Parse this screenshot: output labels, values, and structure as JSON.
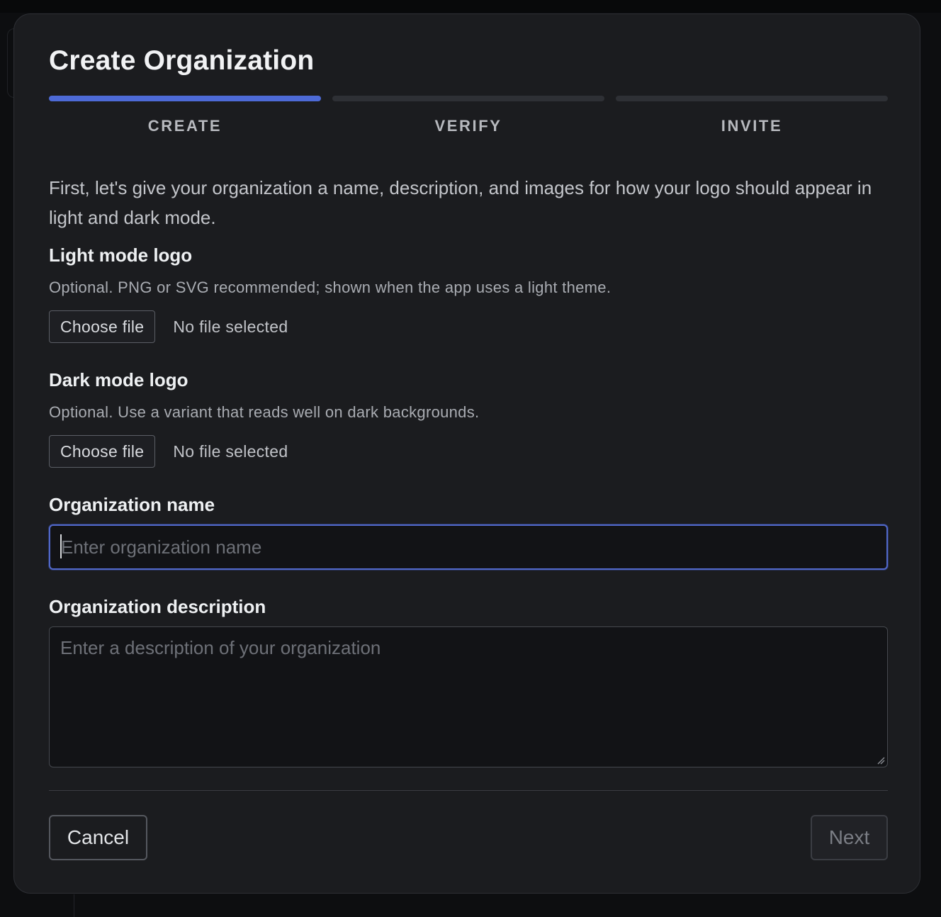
{
  "modal": {
    "title": "Create Organization",
    "intro": "First, let's give your organization a name, description, and images for how your logo should appear in light and dark mode."
  },
  "steps": [
    {
      "label": "CREATE",
      "active": true
    },
    {
      "label": "VERIFY",
      "active": false
    },
    {
      "label": "INVITE",
      "active": false
    }
  ],
  "light_logo": {
    "label": "Light mode logo",
    "hint": "Optional. PNG or SVG recommended; shown when the app uses a light theme.",
    "button": "Choose file",
    "status": "No file selected"
  },
  "dark_logo": {
    "label": "Dark mode logo",
    "hint": "Optional. Use a variant that reads well on dark backgrounds.",
    "button": "Choose file",
    "status": "No file selected"
  },
  "org_name": {
    "label": "Organization name",
    "value": "",
    "placeholder": "Enter organization name"
  },
  "org_description": {
    "label": "Organization description",
    "value": "",
    "placeholder": "Enter a description of your organization"
  },
  "footer": {
    "cancel_label": "Cancel",
    "next_label": "Next"
  },
  "colors": {
    "accent": "#4d6ad6",
    "modal_background": "#1b1c1f",
    "input_background": "#121316"
  }
}
